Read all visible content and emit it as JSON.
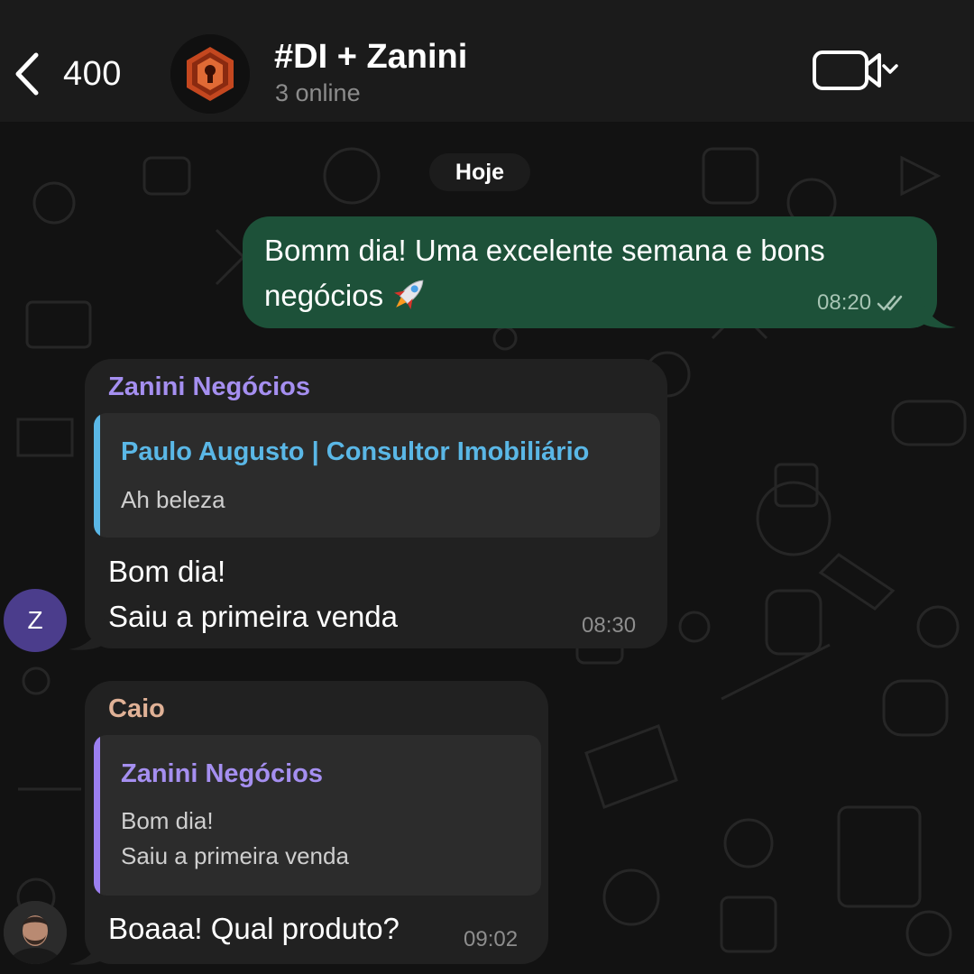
{
  "header": {
    "back_count": "400",
    "title": "#DI + Zanini",
    "subtitle": "3 online"
  },
  "date_divider": "Hoje",
  "messages": [
    {
      "direction": "outgoing",
      "text": "Bomm dia! Uma excelente semana e bons negócios",
      "emoji": "rocket",
      "time": "08:20",
      "status": "read"
    },
    {
      "direction": "incoming",
      "sender": "Zanini Negócios",
      "avatar_initial": "Z",
      "reply": {
        "author": "Paulo Augusto | Consultor Imobiliário",
        "lines": [
          "Ah beleza"
        ]
      },
      "lines": [
        "Bom dia!",
        "Saiu a primeira venda"
      ],
      "time": "08:30"
    },
    {
      "direction": "incoming",
      "sender": "Caio",
      "reply": {
        "author": "Zanini Negócios",
        "lines": [
          "Bom dia!",
          "Saiu a primeira venda"
        ]
      },
      "lines": [
        "Boaaa! Qual produto?"
      ],
      "time": "09:02"
    }
  ],
  "colors": {
    "outgoing_bubble": "#1d5139",
    "incoming_bubble": "#212121",
    "sender_zanini": "#a58ff0",
    "sender_caio": "#e0b196",
    "reply_paulo": "#5ab7e6",
    "reply_bar_paulo": "#5ab7e6",
    "reply_bar_zanini": "#9b7ff0"
  },
  "icons": [
    "back-chevron-icon",
    "video-camera-icon",
    "chevron-down-icon",
    "double-check-icon",
    "rocket-emoji"
  ]
}
